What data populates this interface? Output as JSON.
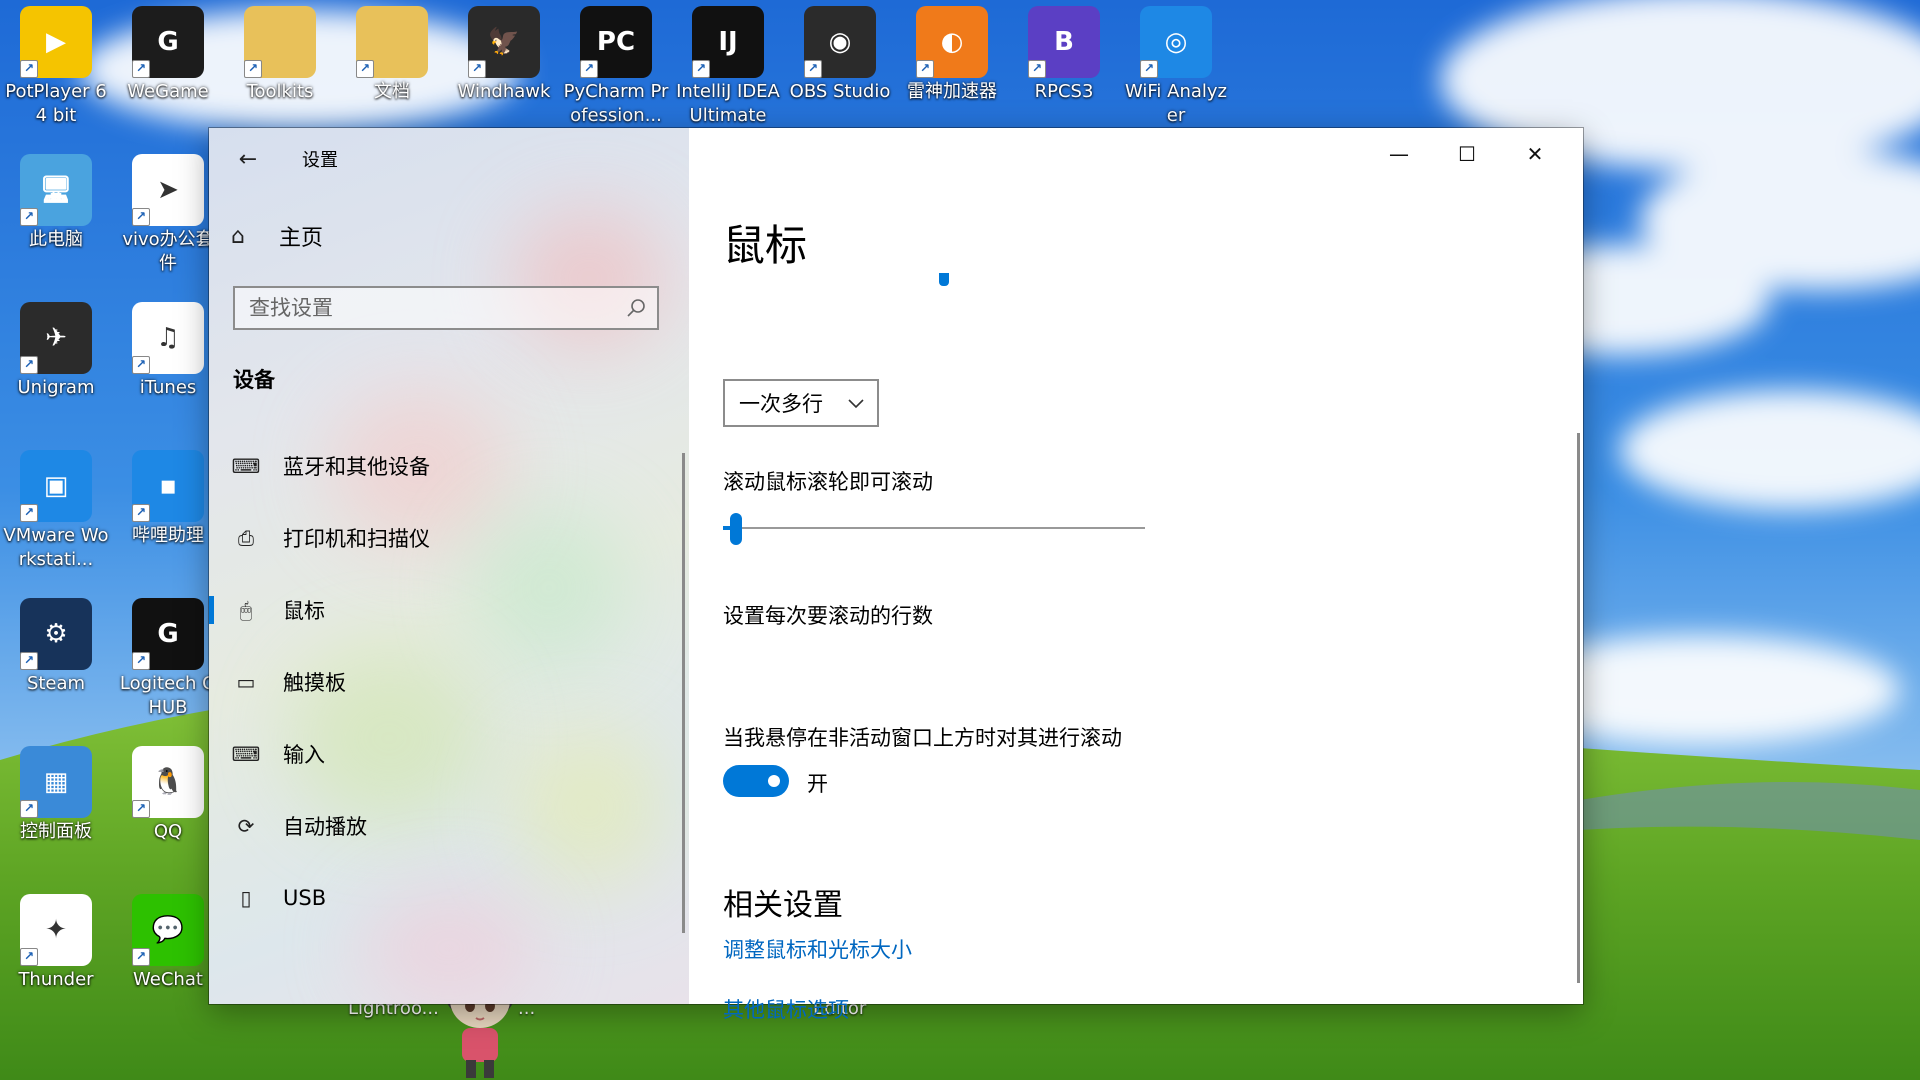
{
  "desktop": {
    "icons": [
      {
        "label": "PotPlayer 64 bit",
        "icon": "potplayer-icon",
        "color": "#f5c400",
        "glyph": "▶"
      },
      {
        "label": "WeGame",
        "icon": "wegame-icon",
        "color": "#1c1c1c",
        "glyph": "G"
      },
      {
        "label": "Toolkits",
        "icon": "folder-icon",
        "color": "#e8c15a",
        "glyph": ""
      },
      {
        "label": "文档",
        "icon": "folder-icon",
        "color": "#e8c15a",
        "glyph": ""
      },
      {
        "label": "Windhawk",
        "icon": "windhawk-icon",
        "color": "#2a2a2a",
        "glyph": "🦅"
      },
      {
        "label": "PyCharm Profession...",
        "icon": "pycharm-icon",
        "color": "#111111",
        "glyph": "PC"
      },
      {
        "label": "IntelliJ IDEA Ultimate 2...",
        "icon": "intellij-icon",
        "color": "#111111",
        "glyph": "IJ"
      },
      {
        "label": "OBS Studio",
        "icon": "obs-icon",
        "color": "#2b2b2b",
        "glyph": "◉"
      },
      {
        "label": "雷神加速器",
        "icon": "leishen-icon",
        "color": "#f07a1a",
        "glyph": "◐"
      },
      {
        "label": "RPCS3",
        "icon": "rpcs3-icon",
        "color": "#5b3fc4",
        "glyph": "B"
      },
      {
        "label": "WiFi Analyzer",
        "icon": "wifi-analyzer-icon",
        "color": "#1e88e5",
        "glyph": "◎"
      },
      {
        "label": "此电脑",
        "icon": "this-pc-icon",
        "color": "#4aa3df",
        "glyph": "🖥"
      },
      {
        "label": "vivo办公套件",
        "icon": "vivo-office-icon",
        "color": "#ffffff",
        "glyph": "➤"
      },
      {
        "label": "Unigram",
        "icon": "unigram-icon",
        "color": "#2b2b2b",
        "glyph": "✈"
      },
      {
        "label": "iTunes",
        "icon": "itunes-icon",
        "color": "#ffffff",
        "glyph": "♫"
      },
      {
        "label": "VMware Workstati...",
        "icon": "vmware-icon",
        "color": "#1e88e5",
        "glyph": "▣"
      },
      {
        "label": "哔哩助理",
        "icon": "bilibili-icon",
        "color": "#1e88e5",
        "glyph": "▪"
      },
      {
        "label": "Steam",
        "icon": "steam-icon",
        "color": "#17335a",
        "glyph": "⚙"
      },
      {
        "label": "Logitech G HUB",
        "icon": "logitech-icon",
        "color": "#111111",
        "glyph": "G"
      },
      {
        "label": "控制面板",
        "icon": "control-panel-icon",
        "color": "#3a8ad8",
        "glyph": "▦"
      },
      {
        "label": "QQ",
        "icon": "qq-icon",
        "color": "#ffffff",
        "glyph": "🐧"
      },
      {
        "label": "Thunder",
        "icon": "thunder-icon",
        "color": "#ffffff",
        "glyph": "✦"
      },
      {
        "label": "WeChat",
        "icon": "wechat-icon",
        "color": "#2dc100",
        "glyph": "💬"
      }
    ],
    "under_window_labels": [
      "Lightroo...",
      "...",
      "Editor"
    ]
  },
  "window": {
    "title": "设置",
    "back_icon": "back-arrow-icon",
    "controls": {
      "minimize": "—",
      "maximize": "☐",
      "close": "✕"
    },
    "nav": {
      "home_label": "主页",
      "search_placeholder": "查找设置",
      "section_title": "设备",
      "items": [
        {
          "label": "蓝牙和其他设备",
          "icon": "bluetooth-devices-icon",
          "glyph": "⌨"
        },
        {
          "label": "打印机和扫描仪",
          "icon": "printer-icon",
          "glyph": "⎙"
        },
        {
          "label": "鼠标",
          "icon": "mouse-icon",
          "glyph": "🖱"
        },
        {
          "label": "触摸板",
          "icon": "touchpad-icon",
          "glyph": "▭"
        },
        {
          "label": "输入",
          "icon": "keyboard-icon",
          "glyph": "⌨"
        },
        {
          "label": "自动播放",
          "icon": "autoplay-icon",
          "glyph": "⟳"
        },
        {
          "label": "USB",
          "icon": "usb-icon",
          "glyph": "▯"
        }
      ],
      "active_index": 2
    },
    "content": {
      "page_title": "鼠标",
      "scroll_label": "滚动鼠标滚轮即可滚动",
      "scroll_value": "一次多行",
      "lines_label": "设置每次要滚动的行数",
      "lines_value_fraction": 0.03,
      "inactive_label": "当我悬停在非活动窗口上方时对其进行滚动",
      "inactive_state": "开",
      "related_title": "相关设置",
      "links": [
        "调整鼠标和光标大小",
        "其他鼠标选项"
      ]
    }
  },
  "colors": {
    "accent": "#0078d7",
    "link": "#0067c0"
  }
}
